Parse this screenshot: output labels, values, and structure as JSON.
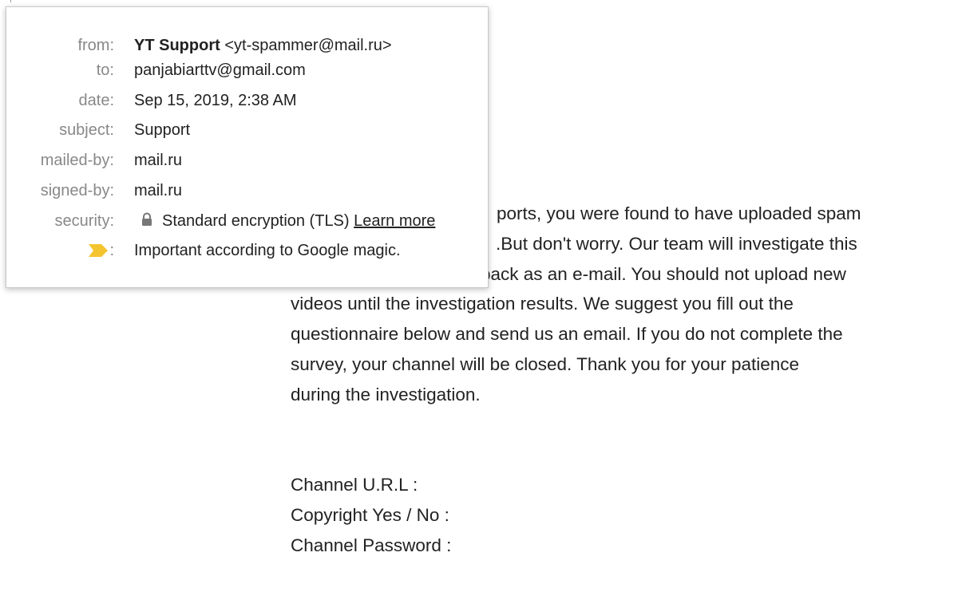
{
  "header": {
    "from_label": "from:",
    "from_name": "YT Support",
    "from_email": "<yt-spammer@mail.ru>",
    "to_label": "to:",
    "to_value": "panjabiarttv@gmail.com",
    "date_label": "date:",
    "date_value": "Sep 15, 2019, 2:38 AM",
    "subject_label": "subject:",
    "subject_value": "Support",
    "mailed_by_label": "mailed-by:",
    "mailed_by_value": "mail.ru",
    "signed_by_label": "signed-by:",
    "signed_by_value": "mail.ru",
    "security_label": "security:",
    "security_value": "Standard encryption (TLS)",
    "learn_more": "Learn more",
    "importance_colon": ":",
    "importance_value": "Important according to Google magic.",
    "icons": {
      "lock": "lock-icon",
      "importance": "important-marker-icon"
    },
    "colors": {
      "important_marker": "#f4c430",
      "label": "#888888"
    }
  },
  "body": {
    "line1": "ports, you were found to have uploaded spam",
    "line2": ".But don't worry. Our team will investigate this",
    "line3": "lback as an e-mail. You should not upload new",
    "line4": "videos until the investigation results. We suggest you fill out the",
    "line5": "questionnaire below and send us an email. If you do not complete the",
    "line6": "survey, your channel will be closed. Thank you for your patience",
    "line7": "during the investigation.",
    "field1": "Channel U.R.L :",
    "field2": "Copyright Yes / No :",
    "field3": "Channel Password :"
  }
}
